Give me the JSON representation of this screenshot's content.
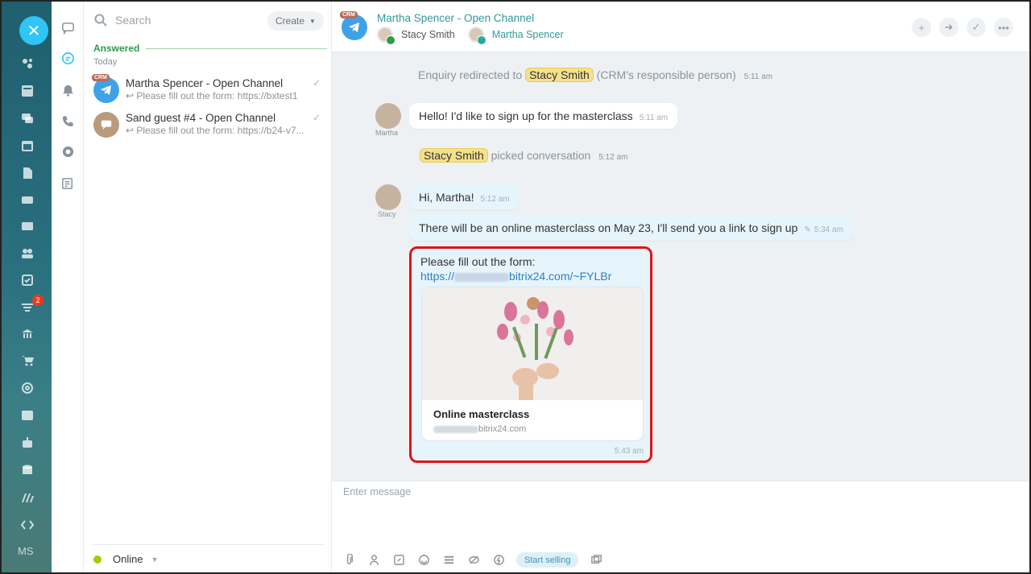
{
  "recent": {
    "search_placeholder": "Search",
    "create_label": "Create",
    "section_label": "Answered",
    "date_label": "Today",
    "items": [
      {
        "name": "Martha Spencer - Open Channel",
        "preview": "Please fill out the form: https://bxtest1",
        "badge": "CRM"
      },
      {
        "name": "Sand guest #4 - Open Channel",
        "preview": "Please fill out the form: https://b24-v7..."
      }
    ],
    "status": "Online"
  },
  "rail": {
    "badge_count": "2",
    "user_initials": "MS"
  },
  "chat": {
    "title": "Martha Spencer - Open Channel",
    "title_badge": "CRM",
    "participants": [
      "Stacy Smith",
      "Martha Spencer"
    ],
    "messages": {
      "sys1": {
        "pre": "Enquiry redirected to",
        "name": "Stacy Smith",
        "post": "(CRM's responsible person)",
        "time": "5:11 am"
      },
      "client_name": "Martha",
      "client_msg": {
        "text": "Hello! I'd like to sign up for the masterclass",
        "time": "5:11 am"
      },
      "sys2": {
        "name": "Stacy Smith",
        "post": "picked conversation",
        "time": "5:12 am"
      },
      "operator_name": "Stacy",
      "op_msg1": {
        "text": "Hi, Martha!",
        "time": "5:12 am"
      },
      "op_msg2": {
        "text": "There will be an online masterclass on May 23, I'll send you a link to sign up",
        "time": "5:34 am"
      },
      "form_msg": {
        "text": "Please fill out the form:",
        "link_prefix": "https://",
        "link_suffix": "bitrix24.com/~FYLBr",
        "card_title": "Online masterclass",
        "card_domain": "bitrix24.com",
        "time": "5:43 am"
      }
    },
    "input_placeholder": "Enter message",
    "start_selling": "Start selling"
  },
  "colors": {
    "accent": "#2fc6f6",
    "green": "#2f9a4a",
    "teal_title": "#2f9a9a",
    "highlight_red": "#e0141a",
    "name_chip": "#f6e08a"
  }
}
